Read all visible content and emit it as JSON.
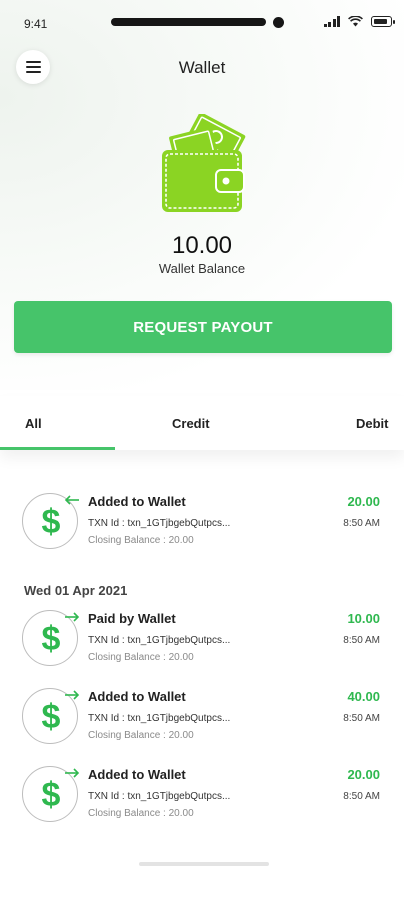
{
  "status_bar": {
    "time": "9:41"
  },
  "header": {
    "title": "Wallet",
    "menu_icon": "hamburger-menu-icon"
  },
  "wallet": {
    "icon": "wallet-with-cash-icon",
    "accent_color": "#8bd423",
    "balance": "10.00",
    "balance_label": "Wallet Balance",
    "payout_button": "REQUEST PAYOUT",
    "button_color": "#46c46a"
  },
  "tabs": [
    {
      "label": "All",
      "active": true
    },
    {
      "label": "Credit",
      "active": false
    },
    {
      "label": "Debit",
      "active": false
    }
  ],
  "groups": [
    {
      "date": "",
      "transactions": [
        {
          "title": "Added to Wallet",
          "txn_id": "TXN Id : txn_1GTjbgebQutpcs...",
          "closing": "Closing Balance : 20.00",
          "amount": "20.00",
          "time": "8:50 AM",
          "direction": "in"
        }
      ]
    },
    {
      "date": "Wed 01 Apr 2021",
      "transactions": [
        {
          "title": "Paid by Wallet",
          "txn_id": "TXN Id : txn_1GTjbgebQutpcs...",
          "closing": "Closing Balance : 20.00",
          "amount": "10.00",
          "time": "8:50 AM",
          "direction": "out"
        },
        {
          "title": "Added to Wallet",
          "txn_id": "TXN Id : txn_1GTjbgebQutpcs...",
          "closing": "Closing Balance : 20.00",
          "amount": "40.00",
          "time": "8:50 AM",
          "direction": "out"
        },
        {
          "title": "Added to Wallet",
          "txn_id": "TXN Id : txn_1GTjbgebQutpcs...",
          "closing": "Closing Balance : 20.00",
          "amount": "20.00",
          "time": "8:50 AM",
          "direction": "out"
        }
      ]
    }
  ],
  "colors": {
    "credit_green": "#2fb84f",
    "tab_indicator": "#46c46a"
  }
}
